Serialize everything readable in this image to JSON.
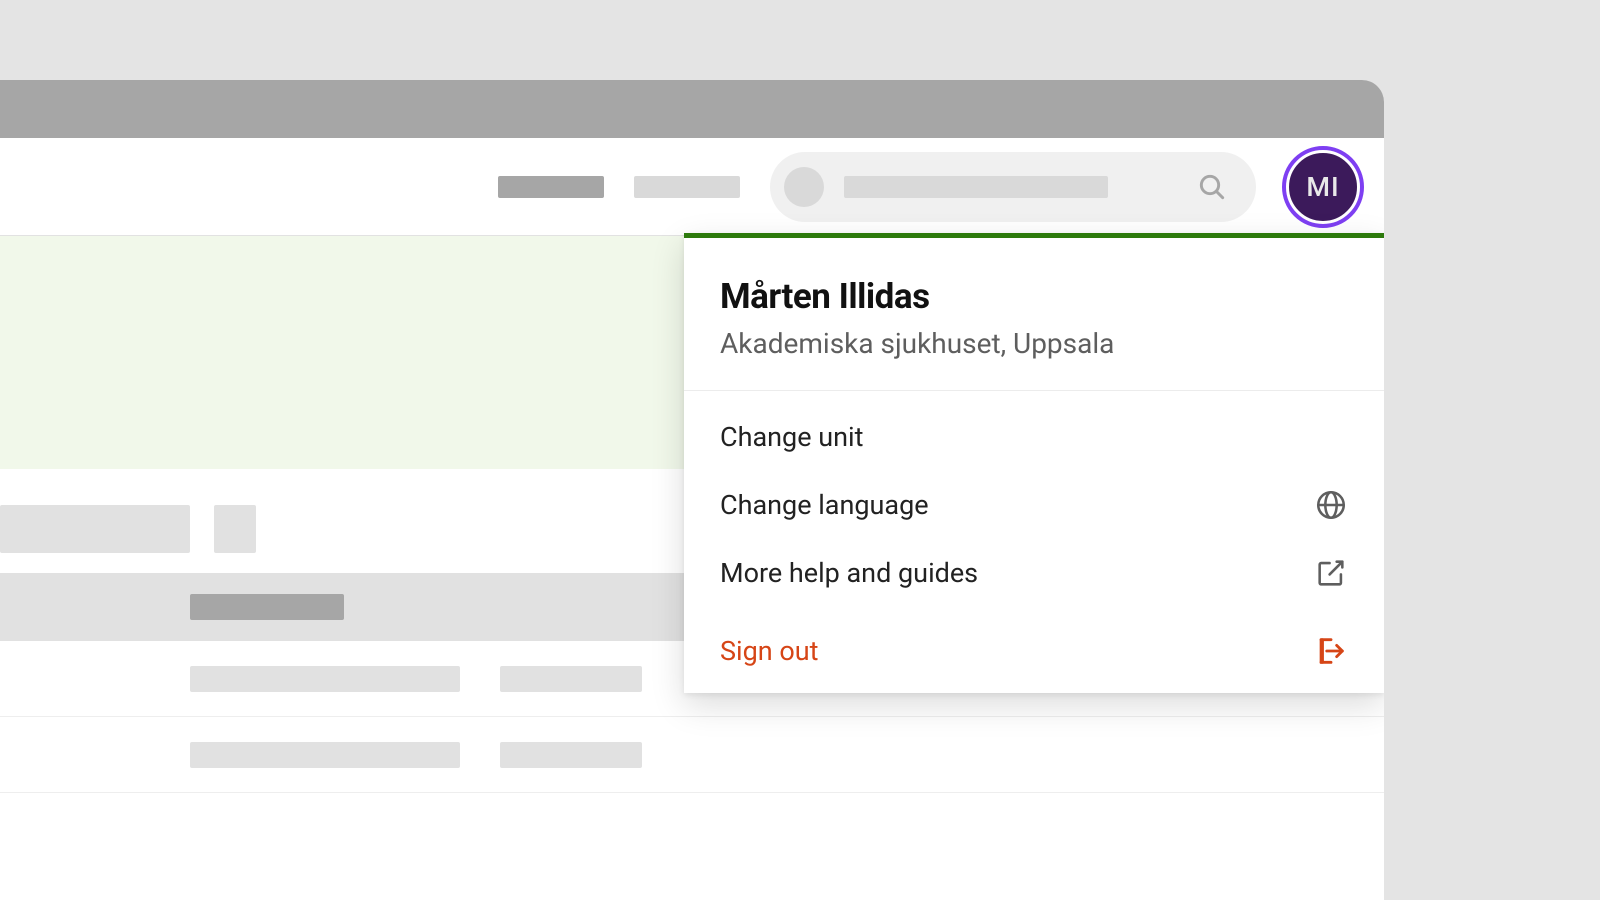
{
  "avatar": {
    "initials": "MI"
  },
  "user": {
    "name": "Mårten Illidas",
    "org": "Akademiska sjukhuset, Uppsala"
  },
  "menu": {
    "change_unit": "Change unit",
    "change_language": "Change language",
    "more_help": "More help and guides",
    "sign_out": "Sign out"
  }
}
